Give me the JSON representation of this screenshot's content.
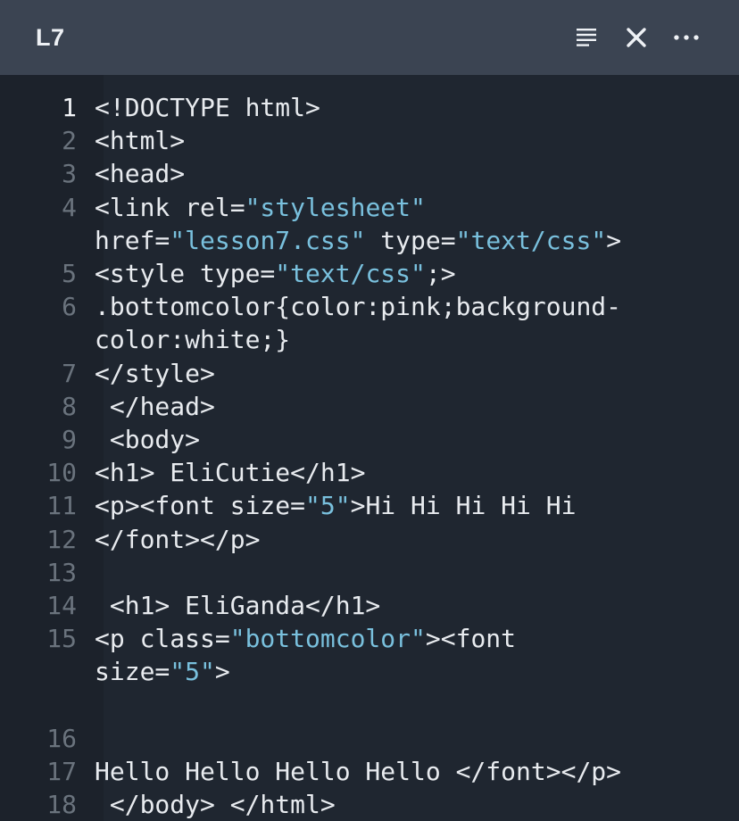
{
  "header": {
    "title": "L7",
    "icons": [
      "format-lines-icon",
      "close-icon",
      "more-dots-icon"
    ]
  },
  "colors": {
    "header_bg": "#3b4452",
    "editor_bg": "#1f2630",
    "text": "#e8ebef",
    "string": "#79c0dd",
    "line_number": "#6a737d"
  },
  "editor": {
    "active_line": 1,
    "rows": [
      {
        "num": "1",
        "active": true,
        "segments": [
          {
            "t": "<!DOCTYPE html>"
          }
        ]
      },
      {
        "num": "2",
        "segments": [
          {
            "t": "<html>"
          }
        ]
      },
      {
        "num": "3",
        "segments": [
          {
            "t": "<head>"
          }
        ]
      },
      {
        "num": "4",
        "segments": [
          {
            "t": "<link rel="
          },
          {
            "t": "\"stylesheet\"",
            "s": 1
          }
        ]
      },
      {
        "num": "",
        "segments": [
          {
            "t": "href="
          },
          {
            "t": "\"lesson7.css\"",
            "s": 1
          },
          {
            "t": " type="
          },
          {
            "t": "\"text/css\"",
            "s": 1
          },
          {
            "t": ">"
          }
        ]
      },
      {
        "num": "5",
        "segments": [
          {
            "t": "<style type="
          },
          {
            "t": "\"text/css\"",
            "s": 1
          },
          {
            "t": ";>"
          }
        ]
      },
      {
        "num": "6",
        "segments": [
          {
            "t": ".bottomcolor{color:pink;background-"
          }
        ]
      },
      {
        "num": "",
        "segments": [
          {
            "t": "color:white;}"
          }
        ]
      },
      {
        "num": "7",
        "segments": [
          {
            "t": "</style>"
          }
        ]
      },
      {
        "num": "8",
        "segments": [
          {
            "t": " </head>"
          }
        ]
      },
      {
        "num": "9",
        "segments": [
          {
            "t": " <body>"
          }
        ]
      },
      {
        "num": "10",
        "segments": [
          {
            "t": "<h1> EliCutie</h1>"
          }
        ]
      },
      {
        "num": "11",
        "segments": [
          {
            "t": "<p><font size="
          },
          {
            "t": "\"5\"",
            "s": 1
          },
          {
            "t": ">Hi Hi Hi Hi Hi"
          }
        ]
      },
      {
        "num": "12",
        "segments": [
          {
            "t": "</font></p>"
          }
        ]
      },
      {
        "num": "13",
        "segments": [
          {
            "t": ""
          }
        ]
      },
      {
        "num": "14",
        "segments": [
          {
            "t": " <h1> EliGanda</h1>"
          }
        ]
      },
      {
        "num": "15",
        "segments": [
          {
            "t": "<p class="
          },
          {
            "t": "\"bottomcolor\"",
            "s": 1
          },
          {
            "t": "><font"
          }
        ]
      },
      {
        "num": "",
        "segments": [
          {
            "t": "size="
          },
          {
            "t": "\"5\"",
            "s": 1
          },
          {
            "t": ">"
          }
        ]
      },
      {
        "num": "",
        "segments": [
          {
            "t": ""
          }
        ]
      },
      {
        "num": "16",
        "segments": [
          {
            "t": ""
          }
        ]
      },
      {
        "num": "17",
        "segments": [
          {
            "t": "Hello Hello Hello Hello </font></p>"
          }
        ]
      },
      {
        "num": "18",
        "segments": [
          {
            "t": " </body> </html>"
          }
        ]
      }
    ]
  }
}
